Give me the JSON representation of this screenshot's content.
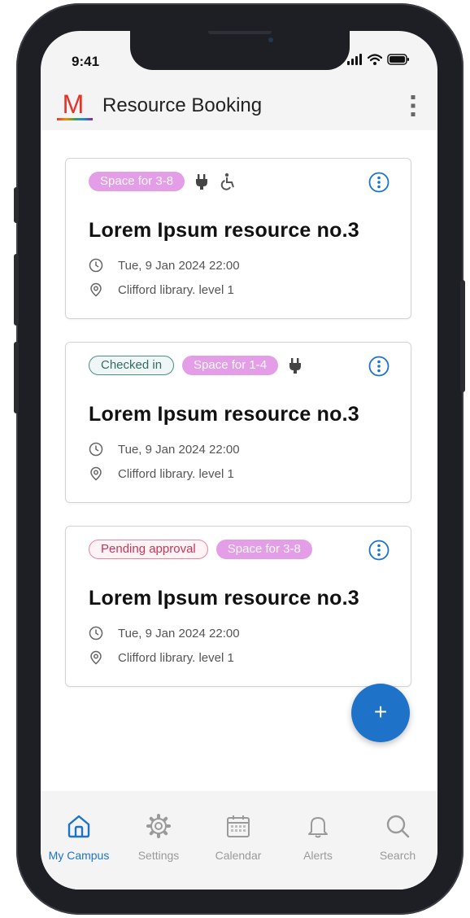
{
  "status_bar": {
    "time": "9:41"
  },
  "app_bar": {
    "title": "Resource Booking",
    "logo_letter": "M"
  },
  "colors": {
    "accent": "#1e73c9",
    "tag_space": "#e49ee8",
    "checked_in": "#4c8f86",
    "pending": "#c6365a"
  },
  "bookings": [
    {
      "tags": [
        "Space for 3-8"
      ],
      "amenities": [
        "plug-icon",
        "wheelchair-icon"
      ],
      "title": "Lorem Ipsum resource no.3",
      "datetime": "Tue, 9 Jan 2024 22:00",
      "location": "Clifford library. level 1"
    },
    {
      "tags": [
        "Checked in",
        "Space for 1-4"
      ],
      "amenities": [
        "plug-icon"
      ],
      "title": "Lorem Ipsum resource no.3",
      "datetime": "Tue, 9 Jan 2024 22:00",
      "location": "Clifford library. level 1"
    },
    {
      "tags": [
        "Pending approval",
        "Space for 3-8"
      ],
      "amenities": [],
      "title": "Lorem Ipsum resource no.3",
      "datetime": "Tue, 9 Jan 2024 22:00",
      "location": "Clifford library. level 1"
    }
  ],
  "fab": {
    "label": "+"
  },
  "nav": [
    {
      "label": "My Campus",
      "icon": "home-icon",
      "active": true
    },
    {
      "label": "Settings",
      "icon": "gear-icon",
      "active": false
    },
    {
      "label": "Calendar",
      "icon": "calendar-icon",
      "active": false
    },
    {
      "label": "Alerts",
      "icon": "bell-icon",
      "active": false
    },
    {
      "label": "Search",
      "icon": "search-icon",
      "active": false
    }
  ]
}
